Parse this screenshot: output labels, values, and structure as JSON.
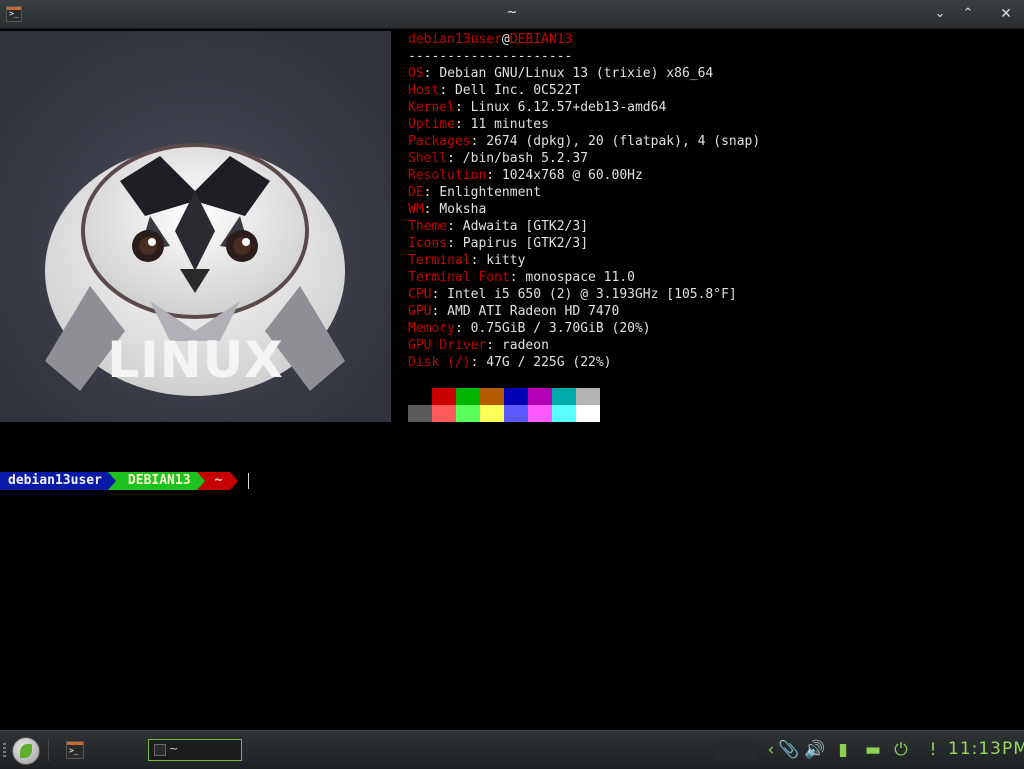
{
  "window": {
    "title": "~",
    "app_icon": "terminal-icon",
    "buttons": {
      "minimize": "⌄",
      "maximize": "⌃",
      "close": "✕"
    }
  },
  "neofetch": {
    "user": "debian13user",
    "at": "@",
    "host": "DEBIAN13",
    "separator": "---------------------",
    "fields": [
      {
        "key": "OS",
        "value": "Debian GNU/Linux 13 (trixie) x86_64"
      },
      {
        "key": "Host",
        "value": "Dell Inc. 0C522T"
      },
      {
        "key": "Kernel",
        "value": "Linux 6.12.57+deb13-amd64"
      },
      {
        "key": "Uptime",
        "value": "11 minutes"
      },
      {
        "key": "Packages",
        "value": "2674 (dpkg), 20 (flatpak), 4 (snap)"
      },
      {
        "key": "Shell",
        "value": "/bin/bash 5.2.37"
      },
      {
        "key": "Resolution",
        "value": "1024x768 @ 60.00Hz"
      },
      {
        "key": "DE",
        "value": "Enlightenment"
      },
      {
        "key": "WM",
        "value": "Moksha"
      },
      {
        "key": "Theme",
        "value": "Adwaita [GTK2/3]"
      },
      {
        "key": "Icons",
        "value": "Papirus [GTK2/3]"
      },
      {
        "key": "Terminal",
        "value": "kitty"
      },
      {
        "key": "Terminal Font",
        "value": "monospace 11.0"
      },
      {
        "key": "CPU",
        "value": "Intel i5 650 (2) @ 3.193GHz [105.8°F]"
      },
      {
        "key": "GPU",
        "value": "AMD ATI Radeon HD 7470"
      },
      {
        "key": "Memory",
        "value": "0.75GiB / 3.70GiB (20%)"
      },
      {
        "key": "GPU Driver",
        "value": "radeon"
      },
      {
        "key": "Disk (/)",
        "value": "47G / 225G (22%)"
      }
    ],
    "palette": {
      "dark": [
        "#000000",
        "#c80000",
        "#00b400",
        "#b45a00",
        "#0000b4",
        "#b400b4",
        "#00aaaa",
        "#b4b4b4"
      ],
      "bright": [
        "#5a5a5a",
        "#ff5a5a",
        "#5aff5a",
        "#ffff5a",
        "#5a5aff",
        "#ff5aff",
        "#5affff",
        "#ffffff"
      ]
    },
    "logo": {
      "text": "LINUX",
      "subject": "penguin-logo"
    }
  },
  "prompt": {
    "user": "debian13user",
    "host": "DEBIAN13",
    "dir": "~"
  },
  "taskbar": {
    "start_icon": "leaf-start-icon",
    "launcher_icon": "terminal-icon",
    "task_title": "~",
    "tray_icons": [
      "chevron-left-icon",
      "paperclip-icon",
      "volume-icon",
      "battery-icon",
      "network-icon",
      "power-icon",
      "alert-icon"
    ],
    "tray_glyphs": [
      "‹",
      "📎",
      "🔊",
      "▮",
      "▬",
      "⏻",
      "!"
    ],
    "clock": "11:13PM"
  },
  "colors": {
    "accent": "#8fd14f",
    "label_red": "#c80000"
  }
}
